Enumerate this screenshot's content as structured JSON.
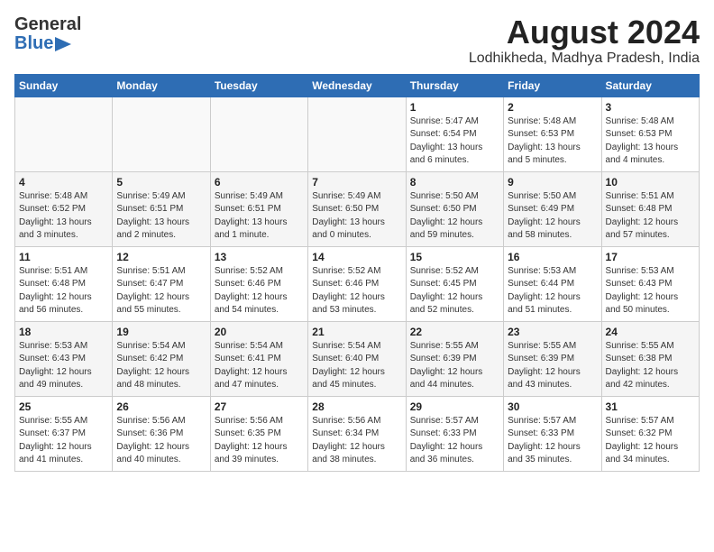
{
  "header": {
    "logo_line1": "General",
    "logo_line2": "Blue",
    "title": "August 2024",
    "subtitle": "Lodhikheda, Madhya Pradesh, India"
  },
  "calendar": {
    "days_of_week": [
      "Sunday",
      "Monday",
      "Tuesday",
      "Wednesday",
      "Thursday",
      "Friday",
      "Saturday"
    ],
    "weeks": [
      [
        {
          "day": "",
          "info": ""
        },
        {
          "day": "",
          "info": ""
        },
        {
          "day": "",
          "info": ""
        },
        {
          "day": "",
          "info": ""
        },
        {
          "day": "1",
          "info": "Sunrise: 5:47 AM\nSunset: 6:54 PM\nDaylight: 13 hours\nand 6 minutes."
        },
        {
          "day": "2",
          "info": "Sunrise: 5:48 AM\nSunset: 6:53 PM\nDaylight: 13 hours\nand 5 minutes."
        },
        {
          "day": "3",
          "info": "Sunrise: 5:48 AM\nSunset: 6:53 PM\nDaylight: 13 hours\nand 4 minutes."
        }
      ],
      [
        {
          "day": "4",
          "info": "Sunrise: 5:48 AM\nSunset: 6:52 PM\nDaylight: 13 hours\nand 3 minutes."
        },
        {
          "day": "5",
          "info": "Sunrise: 5:49 AM\nSunset: 6:51 PM\nDaylight: 13 hours\nand 2 minutes."
        },
        {
          "day": "6",
          "info": "Sunrise: 5:49 AM\nSunset: 6:51 PM\nDaylight: 13 hours\nand 1 minute."
        },
        {
          "day": "7",
          "info": "Sunrise: 5:49 AM\nSunset: 6:50 PM\nDaylight: 13 hours\nand 0 minutes."
        },
        {
          "day": "8",
          "info": "Sunrise: 5:50 AM\nSunset: 6:50 PM\nDaylight: 12 hours\nand 59 minutes."
        },
        {
          "day": "9",
          "info": "Sunrise: 5:50 AM\nSunset: 6:49 PM\nDaylight: 12 hours\nand 58 minutes."
        },
        {
          "day": "10",
          "info": "Sunrise: 5:51 AM\nSunset: 6:48 PM\nDaylight: 12 hours\nand 57 minutes."
        }
      ],
      [
        {
          "day": "11",
          "info": "Sunrise: 5:51 AM\nSunset: 6:48 PM\nDaylight: 12 hours\nand 56 minutes."
        },
        {
          "day": "12",
          "info": "Sunrise: 5:51 AM\nSunset: 6:47 PM\nDaylight: 12 hours\nand 55 minutes."
        },
        {
          "day": "13",
          "info": "Sunrise: 5:52 AM\nSunset: 6:46 PM\nDaylight: 12 hours\nand 54 minutes."
        },
        {
          "day": "14",
          "info": "Sunrise: 5:52 AM\nSunset: 6:46 PM\nDaylight: 12 hours\nand 53 minutes."
        },
        {
          "day": "15",
          "info": "Sunrise: 5:52 AM\nSunset: 6:45 PM\nDaylight: 12 hours\nand 52 minutes."
        },
        {
          "day": "16",
          "info": "Sunrise: 5:53 AM\nSunset: 6:44 PM\nDaylight: 12 hours\nand 51 minutes."
        },
        {
          "day": "17",
          "info": "Sunrise: 5:53 AM\nSunset: 6:43 PM\nDaylight: 12 hours\nand 50 minutes."
        }
      ],
      [
        {
          "day": "18",
          "info": "Sunrise: 5:53 AM\nSunset: 6:43 PM\nDaylight: 12 hours\nand 49 minutes."
        },
        {
          "day": "19",
          "info": "Sunrise: 5:54 AM\nSunset: 6:42 PM\nDaylight: 12 hours\nand 48 minutes."
        },
        {
          "day": "20",
          "info": "Sunrise: 5:54 AM\nSunset: 6:41 PM\nDaylight: 12 hours\nand 47 minutes."
        },
        {
          "day": "21",
          "info": "Sunrise: 5:54 AM\nSunset: 6:40 PM\nDaylight: 12 hours\nand 45 minutes."
        },
        {
          "day": "22",
          "info": "Sunrise: 5:55 AM\nSunset: 6:39 PM\nDaylight: 12 hours\nand 44 minutes."
        },
        {
          "day": "23",
          "info": "Sunrise: 5:55 AM\nSunset: 6:39 PM\nDaylight: 12 hours\nand 43 minutes."
        },
        {
          "day": "24",
          "info": "Sunrise: 5:55 AM\nSunset: 6:38 PM\nDaylight: 12 hours\nand 42 minutes."
        }
      ],
      [
        {
          "day": "25",
          "info": "Sunrise: 5:55 AM\nSunset: 6:37 PM\nDaylight: 12 hours\nand 41 minutes."
        },
        {
          "day": "26",
          "info": "Sunrise: 5:56 AM\nSunset: 6:36 PM\nDaylight: 12 hours\nand 40 minutes."
        },
        {
          "day": "27",
          "info": "Sunrise: 5:56 AM\nSunset: 6:35 PM\nDaylight: 12 hours\nand 39 minutes."
        },
        {
          "day": "28",
          "info": "Sunrise: 5:56 AM\nSunset: 6:34 PM\nDaylight: 12 hours\nand 38 minutes."
        },
        {
          "day": "29",
          "info": "Sunrise: 5:57 AM\nSunset: 6:33 PM\nDaylight: 12 hours\nand 36 minutes."
        },
        {
          "day": "30",
          "info": "Sunrise: 5:57 AM\nSunset: 6:33 PM\nDaylight: 12 hours\nand 35 minutes."
        },
        {
          "day": "31",
          "info": "Sunrise: 5:57 AM\nSunset: 6:32 PM\nDaylight: 12 hours\nand 34 minutes."
        }
      ]
    ]
  }
}
